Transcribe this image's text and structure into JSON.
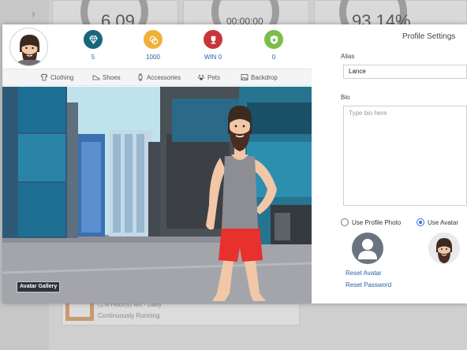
{
  "background": {
    "stats": [
      "6.09",
      "00:00:00",
      "93.14%"
    ],
    "task_line1": "(1-8 Hour(s) left - Daily",
    "task_line2": "Continuously Running"
  },
  "stats": [
    {
      "icon": "diamond-icon",
      "value": "5",
      "color": "#17677d"
    },
    {
      "icon": "coins-icon",
      "value": "1000",
      "color": "#f0b13a"
    },
    {
      "icon": "trophy-icon",
      "value": "WIN 0",
      "color": "#c9363a"
    },
    {
      "icon": "star-badge-icon",
      "value": "0",
      "color": "#7cbd4b"
    }
  ],
  "tabs": [
    {
      "label": "Clothing",
      "icon": "shirt-icon"
    },
    {
      "label": "Shoes",
      "icon": "shoe-icon"
    },
    {
      "label": "Accessories",
      "icon": "accessory-icon"
    },
    {
      "label": "Pets",
      "icon": "paw-icon"
    },
    {
      "label": "Backdrop",
      "icon": "image-icon"
    }
  ],
  "scene": {
    "gallery_button": "Avatar Gallery"
  },
  "settings": {
    "title": "Profile Settings",
    "alias_label": "Alias",
    "alias_value": "Lance",
    "bio_label": "Bio",
    "bio_placeholder": "Type bio here",
    "radio_photo": "Use Profile Photo",
    "radio_avatar": "Use Avatar",
    "radio_selected": "Use Avatar",
    "reset_avatar": "Reset Avatar",
    "reset_password": "Reset Password"
  }
}
